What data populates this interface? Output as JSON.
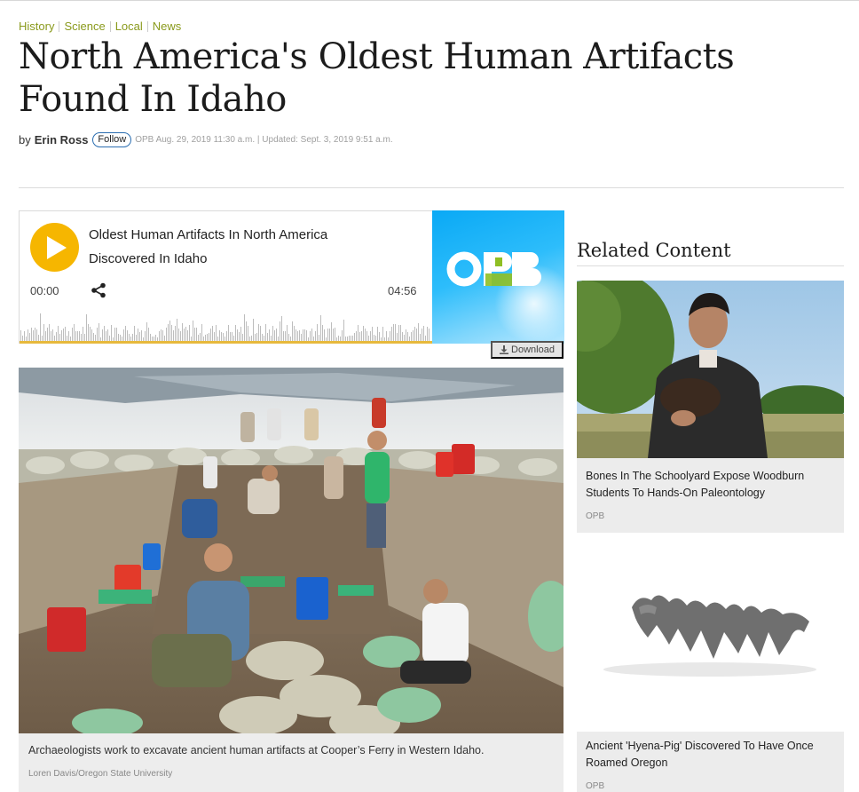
{
  "tags": [
    "History",
    "Science",
    "Local",
    "News"
  ],
  "headline": "North America's Oldest Human Artifacts Found In Idaho",
  "byline": {
    "by": "by",
    "author": "Erin Ross",
    "follow_label": "Follow",
    "meta": "OPB Aug. 29, 2019 11:30 a.m. | Updated: Sept. 3, 2019 9:51 a.m."
  },
  "audio": {
    "title": "Oldest Human Artifacts In North America Discovered In Idaho",
    "time_start": "00:00",
    "time_end": "04:56",
    "thumb_logo": "OPB",
    "download_label": "Download",
    "play_icon": "play-icon",
    "share_icon": "share-icon"
  },
  "main_photo": {
    "caption": "Archaeologists work to excavate ancient human artifacts at Cooper’s Ferry in Western Idaho.",
    "credit": "Loren Davis/Oregon State University"
  },
  "related": {
    "heading": "Related Content",
    "items": [
      {
        "title": "Bones In The Schoolyard Expose Woodburn Students To Hands-On Paleontology",
        "source": "OPB"
      },
      {
        "title": "Ancient 'Hyena-Pig' Discovered To Have Once Roamed Oregon",
        "source": "OPB"
      }
    ]
  },
  "colors": {
    "tag_green": "#8a9a1c",
    "play_yellow": "#f6b600",
    "opb_blue": "#0aa9f5",
    "follow_border": "#2a6db0"
  }
}
